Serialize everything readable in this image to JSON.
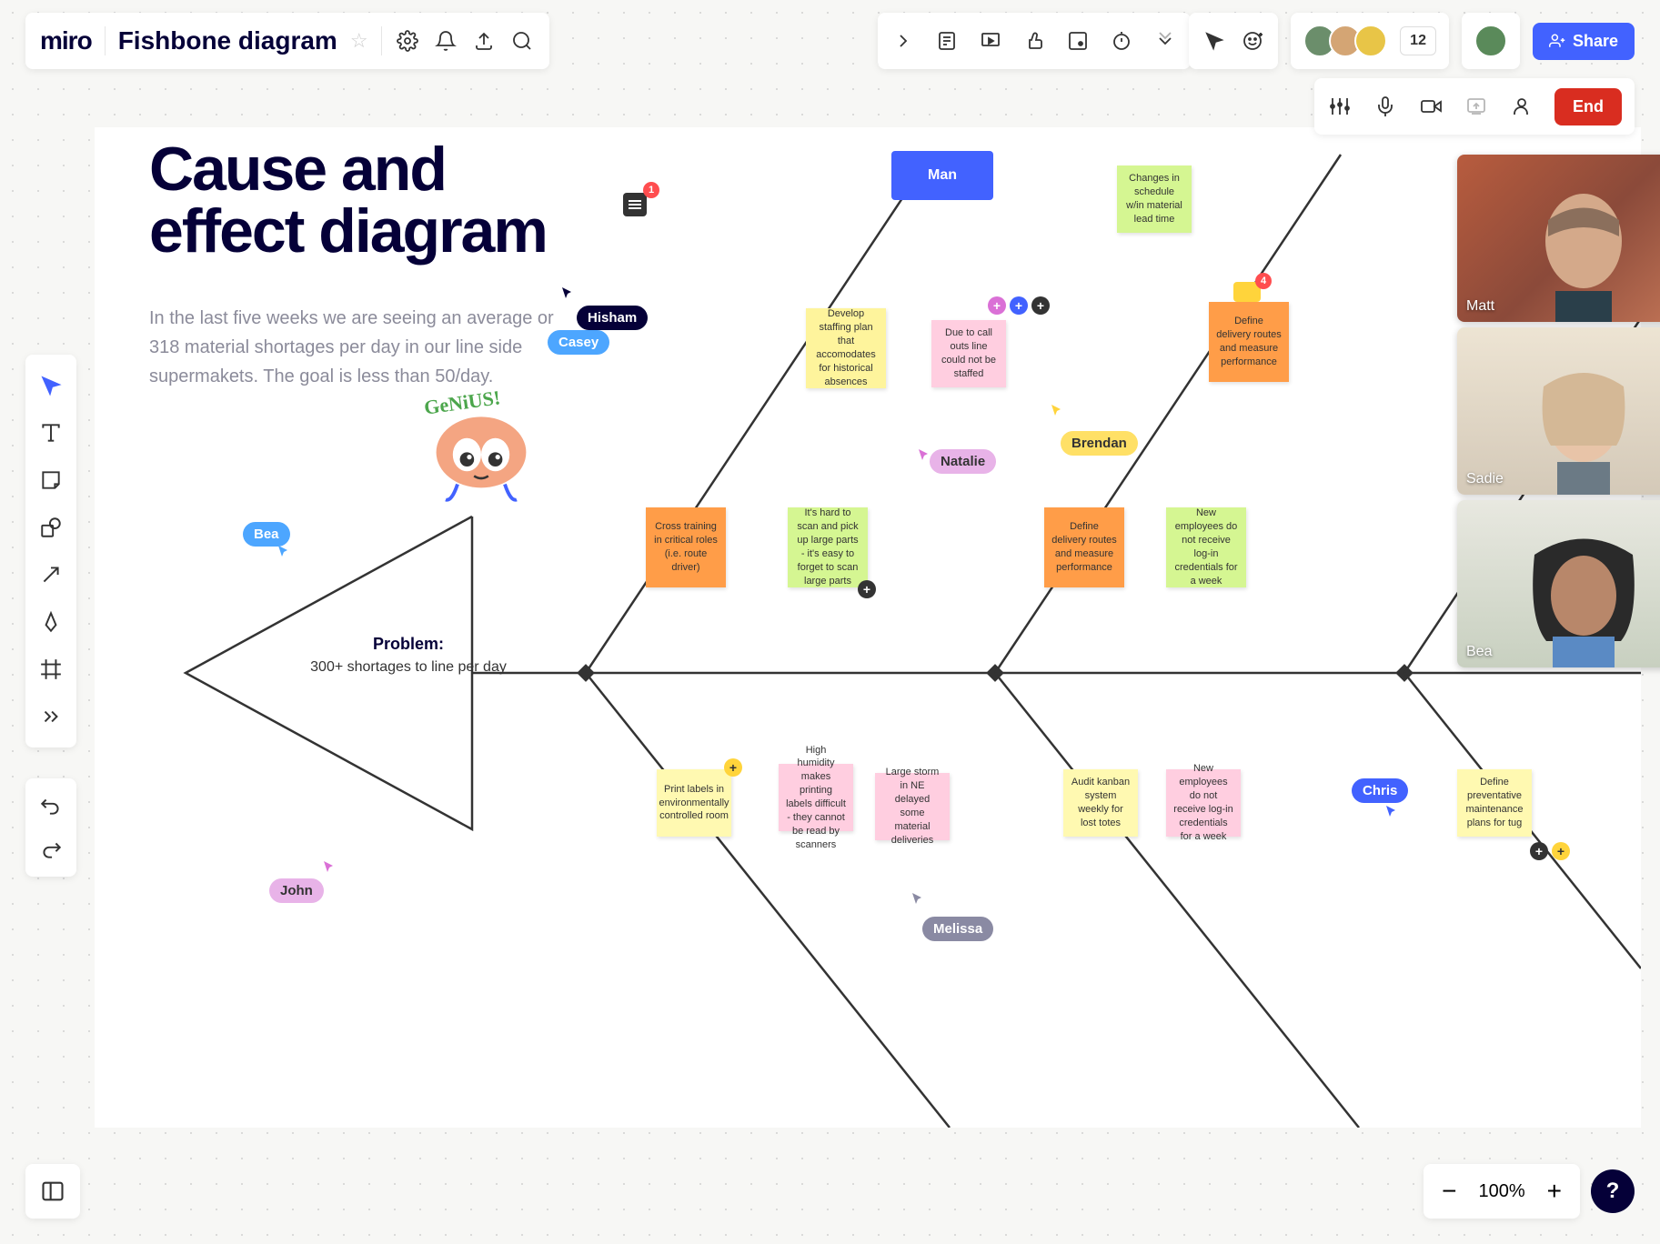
{
  "board": {
    "title": "Fishbone diagram"
  },
  "collab": {
    "count": "12",
    "share": "Share",
    "end": "End"
  },
  "zoom": {
    "level": "100%"
  },
  "canvas": {
    "title_l1": "Cause and",
    "title_l2": "effect diagram",
    "subtitle": "In the last five weeks we are seeing an average or 318 material shortages per day in our line side supermakets. The goal is less than 50/day.",
    "comment_count": "1",
    "problem_h": "Problem:",
    "problem_t": "300+ shortages to line per day",
    "genius": "GeNiUS!"
  },
  "header": {
    "man": "Man"
  },
  "cursors": {
    "bea": "Bea",
    "casey": "Casey",
    "hisham": "Hisham",
    "natalie": "Natalie",
    "brendan": "Brendan",
    "john": "John",
    "melissa": "Melissa",
    "chris": "Chris"
  },
  "stickies": {
    "s1": "Develop staffing plan that accomodates for historical absences",
    "s2": "Due to call outs line could not be staffed",
    "s3": "Changes in schedule w/in material lead time",
    "s4": "Define delivery routes and measure performance",
    "s5": "Cross training in critical roles (i.e. route driver)",
    "s6": "It's hard to scan and pick up large parts - it's easy to forget to scan large parts",
    "s7": "Define delivery routes and measure performance",
    "s8": "New employees do not receive log-in credentials for a week",
    "s9": "Print labels in environmentally controlled room",
    "s10": "High humidity makes printing labels difficult - they cannot be read by scanners",
    "s11": "Large storm in NE delayed some material deliveries",
    "s12": "Audit kanban system weekly for lost totes",
    "s13": "New employees do not receive log-in credentials for a week",
    "s14": "Define preventative maintenance plans for tug"
  },
  "badge4": "4",
  "videos": {
    "v1": "Matt",
    "v2": "Sadie",
    "v3": "Bea"
  }
}
